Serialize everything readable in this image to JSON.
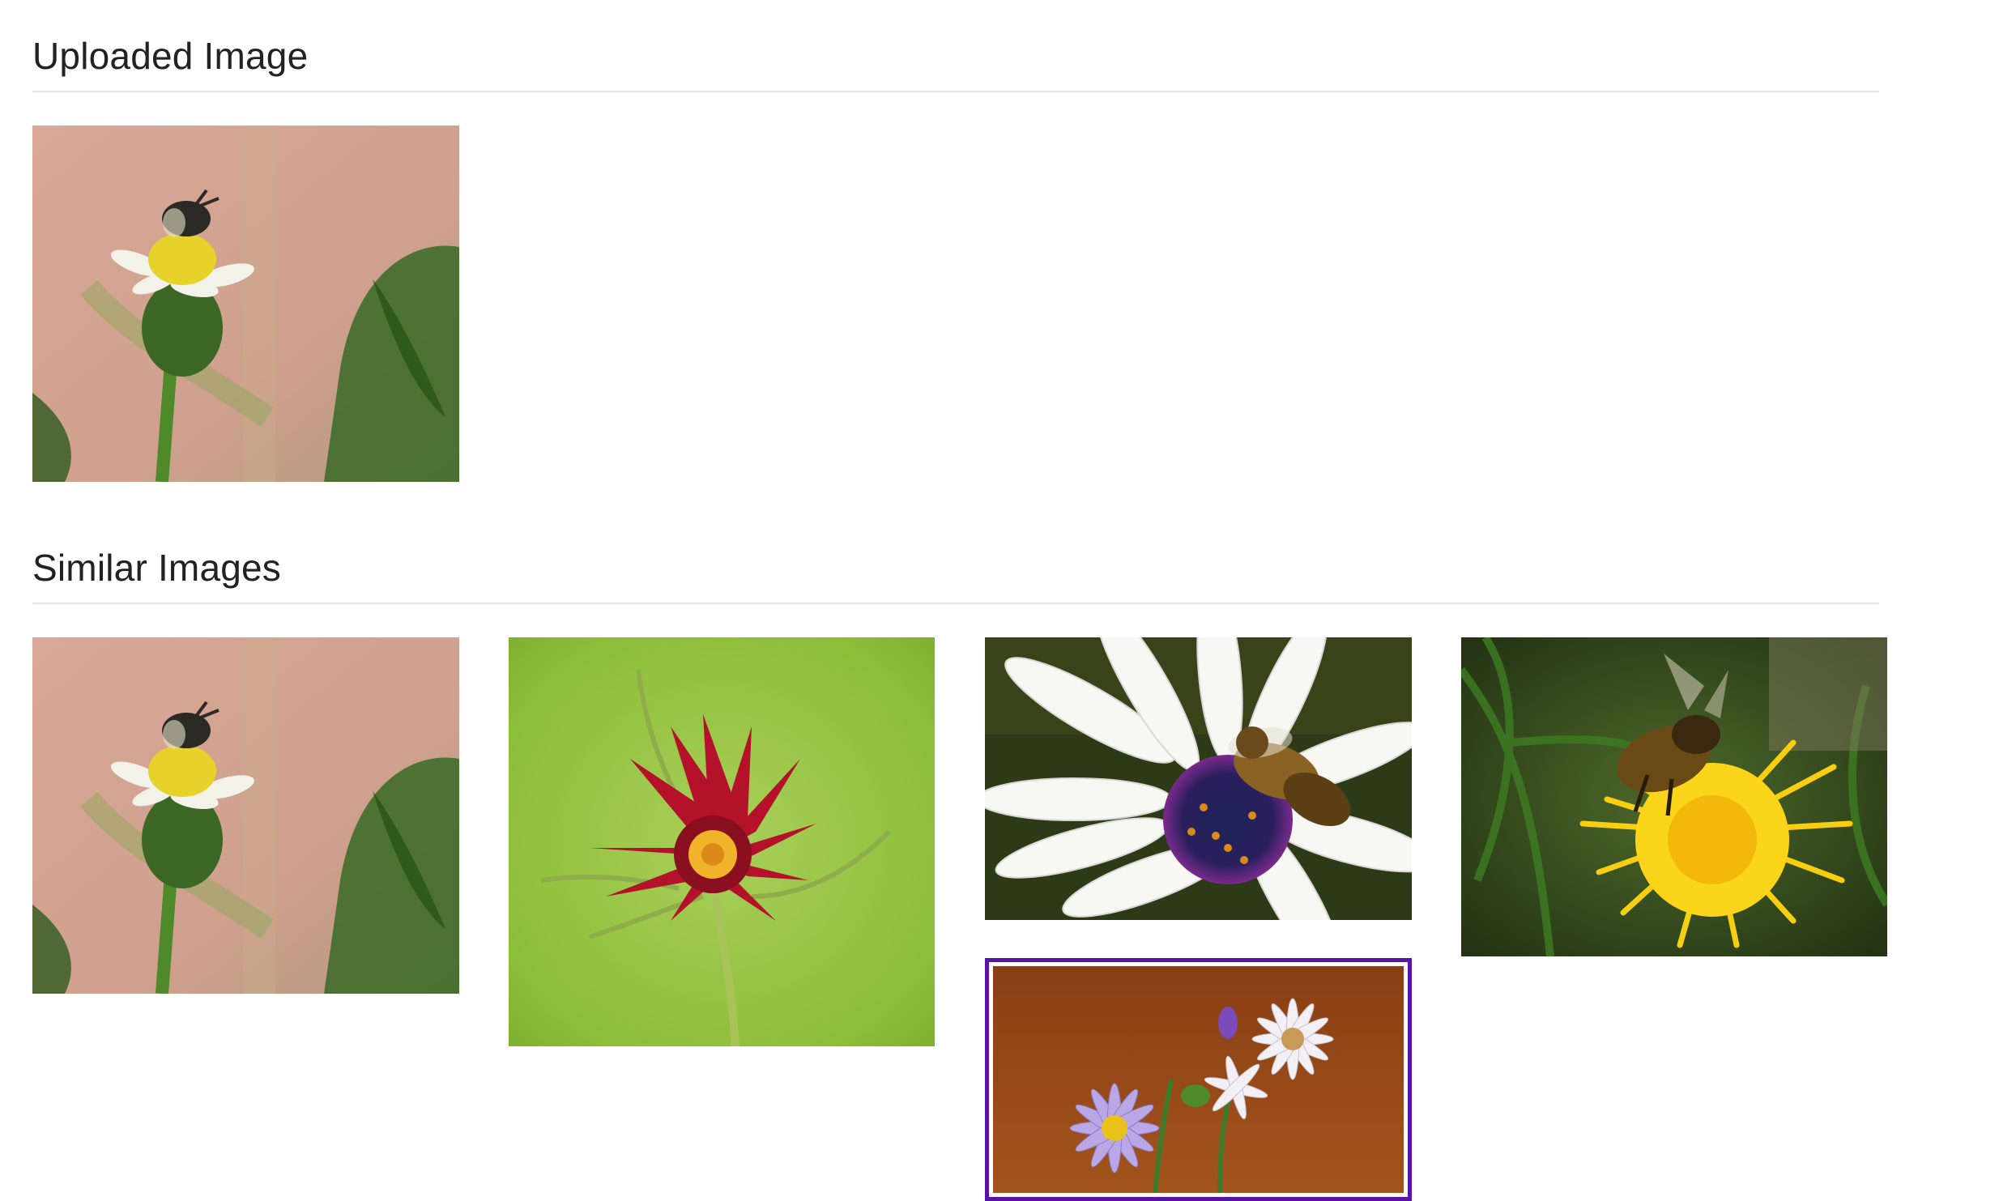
{
  "uploaded_section": {
    "title": "Uploaded Image",
    "image": {
      "subject": "bee-on-white-flower",
      "icon": "photo-bee-white-flower"
    }
  },
  "similar_section": {
    "title": "Similar Images",
    "images": [
      {
        "subject": "bee-on-white-flower",
        "icon": "photo-bee-white-flower"
      },
      {
        "subject": "red-gaillardia-flower",
        "icon": "photo-red-flower"
      },
      {
        "subject": "bee-on-white-daisy",
        "icon": "photo-bee-daisy"
      },
      {
        "subject": "bee-on-yellow-dandelion",
        "icon": "photo-bee-dandelion"
      },
      {
        "subject": "purple-and-white-asters",
        "icon": "photo-asters",
        "selected": true
      }
    ]
  },
  "colors": {
    "selection_border": "#5b12a8",
    "divider": "#e6e6e6",
    "heading_text": "#222222"
  }
}
